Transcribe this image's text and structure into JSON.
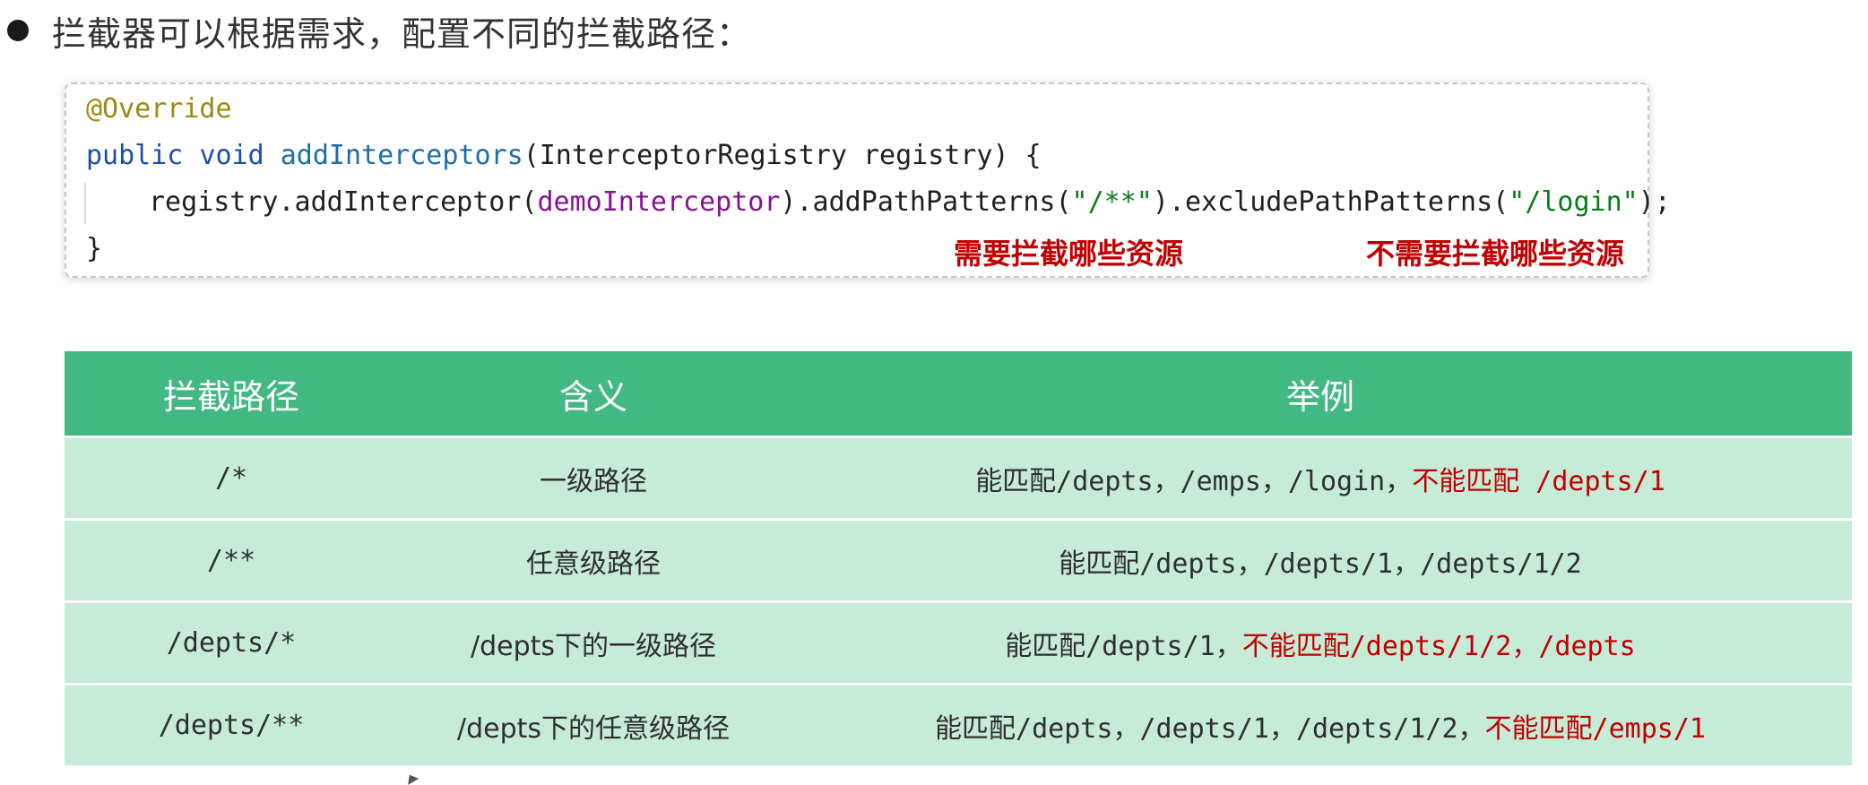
{
  "bullet": {
    "text": "拦截器可以根据需求，配置不同的拦截路径："
  },
  "code": {
    "line1": "@Override",
    "line2": {
      "kw1": "public",
      "kw2": "void",
      "method": "addInterceptors",
      "rest": "(InterceptorRegistry registry) {"
    },
    "line3": {
      "pre": "registry.addInterceptor(",
      "field": "demoInterceptor",
      "mid": ").addPathPatterns(",
      "str1": "\"/**\"",
      "mid2": ").excludePathPatterns(",
      "str2": "\"/login\"",
      "post": ");"
    },
    "line4": "}",
    "annotation_include": "需要拦截哪些资源",
    "annotation_exclude": "不需要拦截哪些资源"
  },
  "table": {
    "headers": [
      "拦截路径",
      "含义",
      "举例"
    ],
    "rows": [
      {
        "path": "/*",
        "meaning": "一级路径",
        "example_match": "能匹配/depts，/emps，/login，",
        "example_nomatch": "不能匹配 /depts/1"
      },
      {
        "path": "/**",
        "meaning": "任意级路径",
        "example_match": "能匹配/depts，/depts/1，/depts/1/2",
        "example_nomatch": ""
      },
      {
        "path": "/depts/*",
        "meaning": "/depts下的一级路径",
        "example_match": "能匹配/depts/1，",
        "example_nomatch": "不能匹配/depts/1/2，/depts"
      },
      {
        "path": "/depts/**",
        "meaning": "/depts下的任意级路径",
        "example_match": "能匹配/depts，/depts/1，/depts/1/2，",
        "example_nomatch": "不能匹配/emps/1"
      }
    ]
  },
  "colors": {
    "header_bg": "#42b883",
    "row_bg": "#c6ebd7",
    "highlight_red": "#c00000"
  }
}
